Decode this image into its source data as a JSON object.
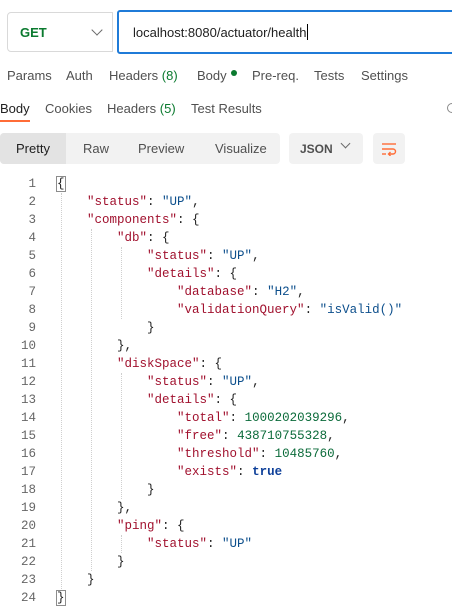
{
  "request": {
    "method": "GET",
    "url": "localhost:8080/actuator/health"
  },
  "request_tabs": {
    "params": "Params",
    "auth": "Auth",
    "headers": "Headers",
    "headers_count": "(8)",
    "body": "Body",
    "prereq": "Pre-req.",
    "tests": "Tests",
    "settings": "Settings"
  },
  "response_tabs": {
    "body": "Body",
    "cookies": "Cookies",
    "headers": "Headers",
    "headers_count": "(5)",
    "test_results": "Test Results"
  },
  "view_modes": {
    "pretty": "Pretty",
    "raw": "Raw",
    "preview": "Preview",
    "visualize": "Visualize"
  },
  "format_select": "JSON",
  "code_lines": [
    {
      "num": "1",
      "indent": "",
      "parts": [
        [
          "p",
          "{"
        ]
      ]
    },
    {
      "num": "2",
      "indent": "    ",
      "parts": [
        [
          "k",
          "\"status\""
        ],
        [
          "p",
          ": "
        ],
        [
          "s",
          "\"UP\""
        ],
        [
          "p",
          ","
        ]
      ]
    },
    {
      "num": "3",
      "indent": "    ",
      "parts": [
        [
          "k",
          "\"components\""
        ],
        [
          "p",
          ": {"
        ]
      ]
    },
    {
      "num": "4",
      "indent": "        ",
      "parts": [
        [
          "k",
          "\"db\""
        ],
        [
          "p",
          ": {"
        ]
      ]
    },
    {
      "num": "5",
      "indent": "            ",
      "parts": [
        [
          "k",
          "\"status\""
        ],
        [
          "p",
          ": "
        ],
        [
          "s",
          "\"UP\""
        ],
        [
          "p",
          ","
        ]
      ]
    },
    {
      "num": "6",
      "indent": "            ",
      "parts": [
        [
          "k",
          "\"details\""
        ],
        [
          "p",
          ": {"
        ]
      ]
    },
    {
      "num": "7",
      "indent": "                ",
      "parts": [
        [
          "k",
          "\"database\""
        ],
        [
          "p",
          ": "
        ],
        [
          "s",
          "\"H2\""
        ],
        [
          "p",
          ","
        ]
      ]
    },
    {
      "num": "8",
      "indent": "                ",
      "parts": [
        [
          "k",
          "\"validationQuery\""
        ],
        [
          "p",
          ": "
        ],
        [
          "s",
          "\"isValid()\""
        ]
      ]
    },
    {
      "num": "9",
      "indent": "            ",
      "parts": [
        [
          "p",
          "}"
        ]
      ]
    },
    {
      "num": "10",
      "indent": "        ",
      "parts": [
        [
          "p",
          "},"
        ]
      ]
    },
    {
      "num": "11",
      "indent": "        ",
      "parts": [
        [
          "k",
          "\"diskSpace\""
        ],
        [
          "p",
          ": {"
        ]
      ]
    },
    {
      "num": "12",
      "indent": "            ",
      "parts": [
        [
          "k",
          "\"status\""
        ],
        [
          "p",
          ": "
        ],
        [
          "s",
          "\"UP\""
        ],
        [
          "p",
          ","
        ]
      ]
    },
    {
      "num": "13",
      "indent": "            ",
      "parts": [
        [
          "k",
          "\"details\""
        ],
        [
          "p",
          ": {"
        ]
      ]
    },
    {
      "num": "14",
      "indent": "                ",
      "parts": [
        [
          "k",
          "\"total\""
        ],
        [
          "p",
          ": "
        ],
        [
          "n",
          "1000202039296"
        ],
        [
          "p",
          ","
        ]
      ]
    },
    {
      "num": "15",
      "indent": "                ",
      "parts": [
        [
          "k",
          "\"free\""
        ],
        [
          "p",
          ": "
        ],
        [
          "n",
          "438710755328"
        ],
        [
          "p",
          ","
        ]
      ]
    },
    {
      "num": "16",
      "indent": "                ",
      "parts": [
        [
          "k",
          "\"threshold\""
        ],
        [
          "p",
          ": "
        ],
        [
          "n",
          "10485760"
        ],
        [
          "p",
          ","
        ]
      ]
    },
    {
      "num": "17",
      "indent": "                ",
      "parts": [
        [
          "k",
          "\"exists\""
        ],
        [
          "p",
          ": "
        ],
        [
          "b",
          "true"
        ]
      ]
    },
    {
      "num": "18",
      "indent": "            ",
      "parts": [
        [
          "p",
          "}"
        ]
      ]
    },
    {
      "num": "19",
      "indent": "        ",
      "parts": [
        [
          "p",
          "},"
        ]
      ]
    },
    {
      "num": "20",
      "indent": "        ",
      "parts": [
        [
          "k",
          "\"ping\""
        ],
        [
          "p",
          ": {"
        ]
      ]
    },
    {
      "num": "21",
      "indent": "            ",
      "parts": [
        [
          "k",
          "\"status\""
        ],
        [
          "p",
          ": "
        ],
        [
          "s",
          "\"UP\""
        ]
      ]
    },
    {
      "num": "22",
      "indent": "        ",
      "parts": [
        [
          "p",
          "}"
        ]
      ]
    },
    {
      "num": "23",
      "indent": "    ",
      "parts": [
        [
          "p",
          "}"
        ]
      ]
    },
    {
      "num": "24",
      "indent": "",
      "parts": [
        [
          "p",
          "}"
        ]
      ]
    }
  ],
  "icons": {
    "method_dropdown": "chevron-down-icon",
    "format_dropdown": "chevron-down-icon",
    "wrap": "wrap-lines-icon",
    "edge": "circle-icon"
  },
  "colors": {
    "method": "#0b7a2f",
    "url_border": "#1f7bd8",
    "active_tab_underline": "#ff6c37",
    "json_key": "#a1112e",
    "json_string": "#0d4f8c",
    "json_number": "#0b6b3a",
    "json_boolean": "#0d3f99",
    "wrap_icon": "#ff6c37"
  }
}
